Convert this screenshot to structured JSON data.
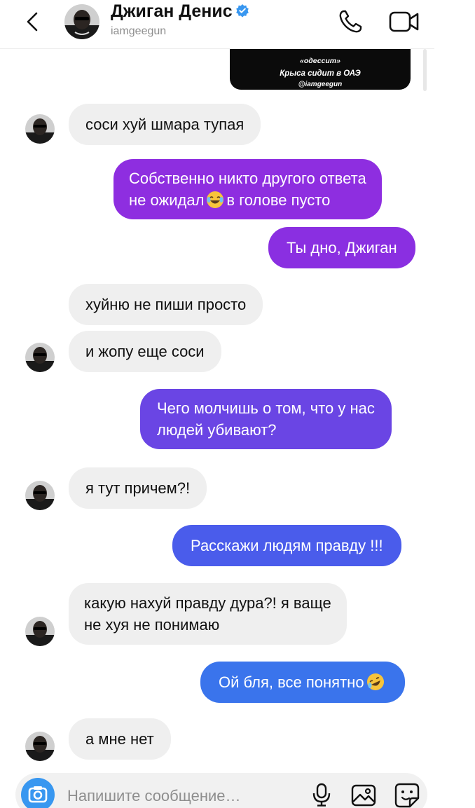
{
  "header": {
    "name": "Джиган Денис",
    "username": "iamgeegun"
  },
  "story_reply": {
    "line1": "«одессит»",
    "line2": "Крыса сидит в ОАЭ",
    "line3": "@iamgeegun"
  },
  "messages": [
    {
      "side": "in",
      "text": "соси хуй шмара тупая"
    },
    {
      "side": "out",
      "text": "Собственно никто другого ответа не ожидал 😂 в голове пусто",
      "line1": "Собственно никто другого ответа",
      "line2a": "не ожидал",
      "line2_emoji": "laughing-tears-emoji",
      "line2b": "в голове пусто",
      "color": "#8e2ee0"
    },
    {
      "side": "out",
      "text": "Ты дно, Джиган",
      "color": "#8a2fe1"
    },
    {
      "side": "in",
      "text": "хуйню не пиши просто"
    },
    {
      "side": "in",
      "text": "и жопу еще соси"
    },
    {
      "side": "out",
      "text": "Чего молчишь о том, что у нас людей убивают?",
      "line1": "Чего молчишь о том, что у нас",
      "line2": "людей убивают?",
      "color": "#6a45e4"
    },
    {
      "side": "in",
      "text": "я тут причем?!"
    },
    {
      "side": "out",
      "text": "Расскажи людям правду !!!",
      "color": "#4a5ceb"
    },
    {
      "side": "in",
      "text": "какую нахуй правду дура?! я ваще не хуя не понимаю",
      "line1": "какую нахуй правду дура?! я ваще",
      "line2": "не хуя не понимаю"
    },
    {
      "side": "out",
      "text": "Ой бля, все понятно 🤣",
      "text_main": "Ой бля, все понятно",
      "emoji": "rofl-emoji",
      "color": "#3a74ec"
    },
    {
      "side": "in",
      "text": "а мне нет"
    }
  ],
  "composer": {
    "placeholder": "Напишите сообщение...",
    "placeholder_display": "Напишите сообщение…"
  },
  "colors": {
    "incoming_bubble": "#efefef",
    "accent_blue": "#3897f0",
    "verified": "#3897f0"
  }
}
